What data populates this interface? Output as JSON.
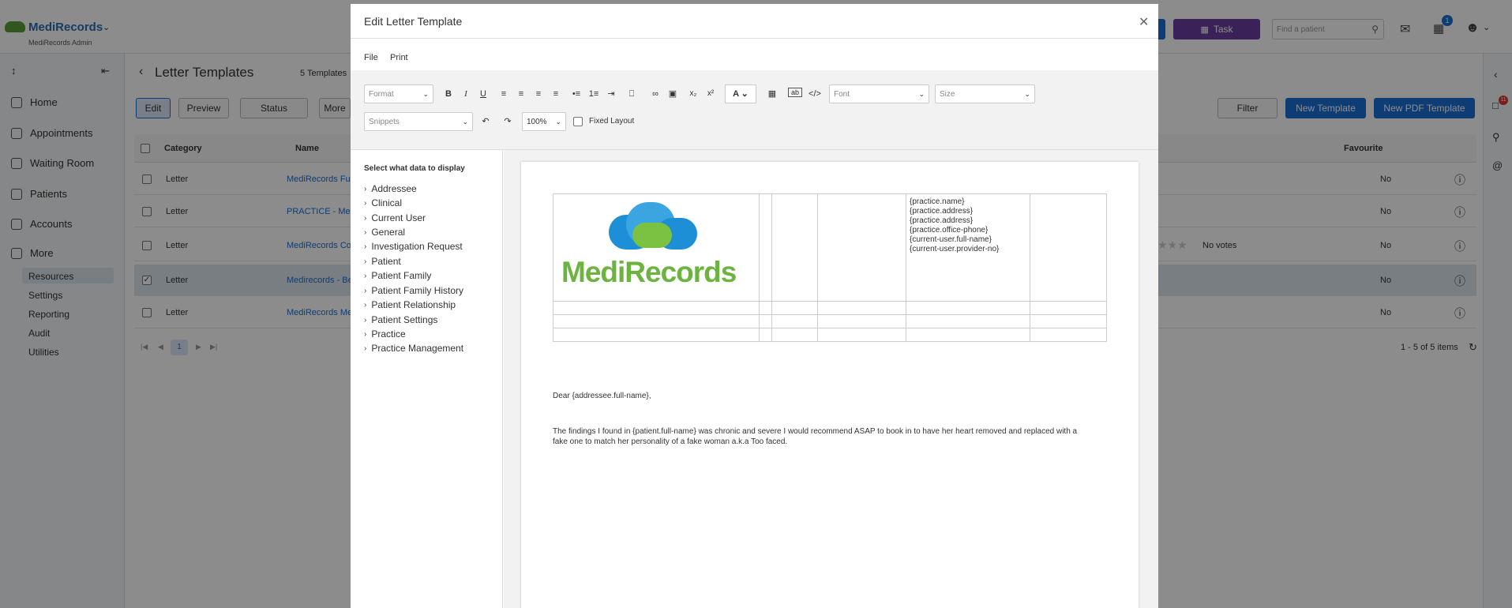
{
  "app": {
    "brand": "MediRecords",
    "subbrand": "MediRecords Admin",
    "task_label": "Task",
    "search_placeholder": "Find a patient",
    "tasks_badge": "1",
    "notifications_badge": "11"
  },
  "sidebar": {
    "items": [
      {
        "label": "Home"
      },
      {
        "label": "Appointments"
      },
      {
        "label": "Waiting Room"
      },
      {
        "label": "Patients"
      },
      {
        "label": "Accounts"
      },
      {
        "label": "More"
      }
    ],
    "sub_items": [
      "Resources",
      "Settings",
      "Reporting",
      "Audit",
      "Utilities"
    ]
  },
  "page": {
    "title": "Letter Templates",
    "count": "5 Templates",
    "buttons": {
      "edit": "Edit",
      "preview": "Preview",
      "status": "Status",
      "more": "More",
      "filter": "Filter",
      "new_template": "New Template",
      "new_pdf": "New PDF Template"
    },
    "columns": {
      "category": "Category",
      "name": "Name",
      "favourite": "Favourite"
    },
    "rows": [
      {
        "category": "Letter",
        "name": "MediRecords Full",
        "rating": "",
        "favourite": "No",
        "checked": false
      },
      {
        "category": "Letter",
        "name": "PRACTICE - MediR",
        "rating": "",
        "favourite": "No",
        "checked": false
      },
      {
        "category": "Letter",
        "name": "MediRecords Con",
        "rating": "No votes",
        "favourite": "No",
        "checked": false
      },
      {
        "category": "Letter",
        "name": "Medirecords - Bel",
        "rating": "",
        "favourite": "No",
        "checked": true
      },
      {
        "category": "Letter",
        "name": "MediRecords Med",
        "rating": "",
        "favourite": "No",
        "checked": false
      }
    ],
    "pagination": {
      "page": "1",
      "summary": "1 - 5 of 5 items"
    }
  },
  "modal": {
    "title": "Edit Letter Template",
    "menu": [
      "File",
      "Print"
    ],
    "toolbar": {
      "format_placeholder": "Format",
      "font_placeholder": "Font",
      "size_placeholder": "Size",
      "snippets_placeholder": "Snippets",
      "zoom": "100%",
      "fixed_layout": "Fixed Layout"
    },
    "panel": {
      "heading": "Select what data to display",
      "items": [
        "Addressee",
        "Clinical",
        "Current User",
        "General",
        "Investigation Request",
        "Patient",
        "Patient Family",
        "Patient Family History",
        "Patient Relationship",
        "Patient Settings",
        "Practice",
        "Practice Management"
      ]
    },
    "letter": {
      "logo_text": "MediRecords",
      "fields": [
        "{practice.name}",
        "{practice.address}",
        "{practice.address}",
        "{practice.office-phone}",
        "{current-user.full-name}",
        "{current-user.provider-no}"
      ],
      "greeting": "Dear {addressee.full-name},",
      "body": "The findings I found in {patient.full-name} was chronic and severe I would recommend ASAP to book in to have her heart removed and replaced with a fake one to match her personality of a fake woman a.k.a Too faced."
    }
  }
}
